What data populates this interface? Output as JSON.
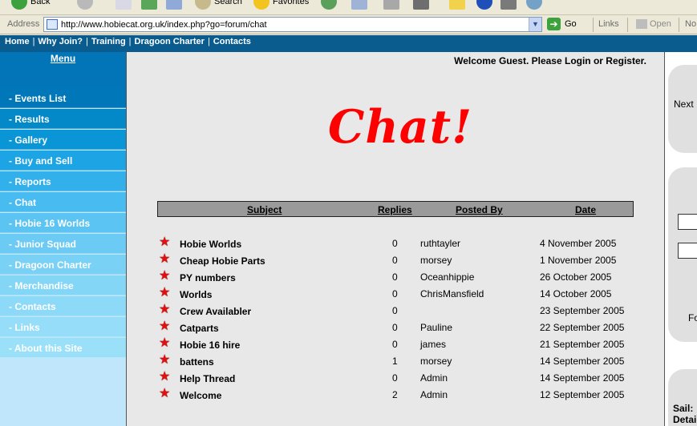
{
  "browser": {
    "toolbar": {
      "back_label": "Back",
      "search_label": "Search",
      "favorites_label": "Favorites"
    },
    "address": {
      "label": "Address",
      "url": "http://www.hobiecat.org.uk/index.php?go=forum/chat",
      "go_label": "Go",
      "links_label": "Links",
      "open_label": "Open",
      "no_label": "No"
    }
  },
  "topnav": {
    "items": [
      "Home",
      "Why Join?",
      "Training",
      "Dragoon Charter",
      "Contacts"
    ]
  },
  "sidebar": {
    "menu_title": "Menu",
    "items": [
      {
        "label": "- Events List",
        "color": "#0077b8"
      },
      {
        "label": "- Results",
        "color": "#0388c8"
      },
      {
        "label": "- Gallery",
        "color": "#0a95d6"
      },
      {
        "label": "- Buy and Sell",
        "color": "#1ca4e5"
      },
      {
        "label": "- Reports",
        "color": "#31b0ec"
      },
      {
        "label": "- Chat",
        "color": "#48bbf0"
      },
      {
        "label": "- Hobie 16 Worlds",
        "color": "#5cc4f3"
      },
      {
        "label": "- Junior Squad",
        "color": "#6ccbf5"
      },
      {
        "label": "- Dragoon Charter",
        "color": "#79d1f6"
      },
      {
        "label": "- Merchandise",
        "color": "#84d6f7"
      },
      {
        "label": "- Contacts",
        "color": "#8ddaf8"
      },
      {
        "label": "- Links",
        "color": "#95ddf8"
      },
      {
        "label": "- About this Site",
        "color": "#9be0f9"
      }
    ]
  },
  "main": {
    "welcome": "Welcome Guest. Please Login or Register.",
    "title": "Chat!",
    "table": {
      "headers": {
        "subject": "Subject",
        "replies": "Replies",
        "posted_by": "Posted By",
        "date": "Date"
      },
      "rows": [
        {
          "subject": "Hobie Worlds",
          "replies": "0",
          "posted_by": "ruthtayler",
          "date": "4 November 2005"
        },
        {
          "subject": "Cheap Hobie Parts",
          "replies": "0",
          "posted_by": "morsey",
          "date": "1 November 2005"
        },
        {
          "subject": "PY numbers",
          "replies": "0",
          "posted_by": "Oceanhippie",
          "date": "26 October 2005"
        },
        {
          "subject": "Worlds",
          "replies": "0",
          "posted_by": "ChrisMansfield",
          "date": "14 October 2005"
        },
        {
          "subject": "Crew Availabler",
          "replies": "0",
          "posted_by": "",
          "date": "23 September 2005"
        },
        {
          "subject": "Catparts",
          "replies": "0",
          "posted_by": "Pauline",
          "date": "22 September 2005"
        },
        {
          "subject": "Hobie 16 hire",
          "replies": "0",
          "posted_by": "james",
          "date": "21 September 2005"
        },
        {
          "subject": "battens",
          "replies": "1",
          "posted_by": "morsey",
          "date": "14 September 2005"
        },
        {
          "subject": "Help Thread",
          "replies": "0",
          "posted_by": "Admin",
          "date": "14 September 2005"
        },
        {
          "subject": "Welcome",
          "replies": "2",
          "posted_by": "Admin",
          "date": "12 September 2005"
        }
      ]
    }
  },
  "rightpane": {
    "next_text": "Next I",
    "fo_text": "Fo",
    "sail_text": "Sail:",
    "detail_text": "Detai"
  },
  "colors": {
    "title_red": "#ff0000",
    "nav_blue": "#0a5c8f",
    "star_red": "#e01010"
  }
}
